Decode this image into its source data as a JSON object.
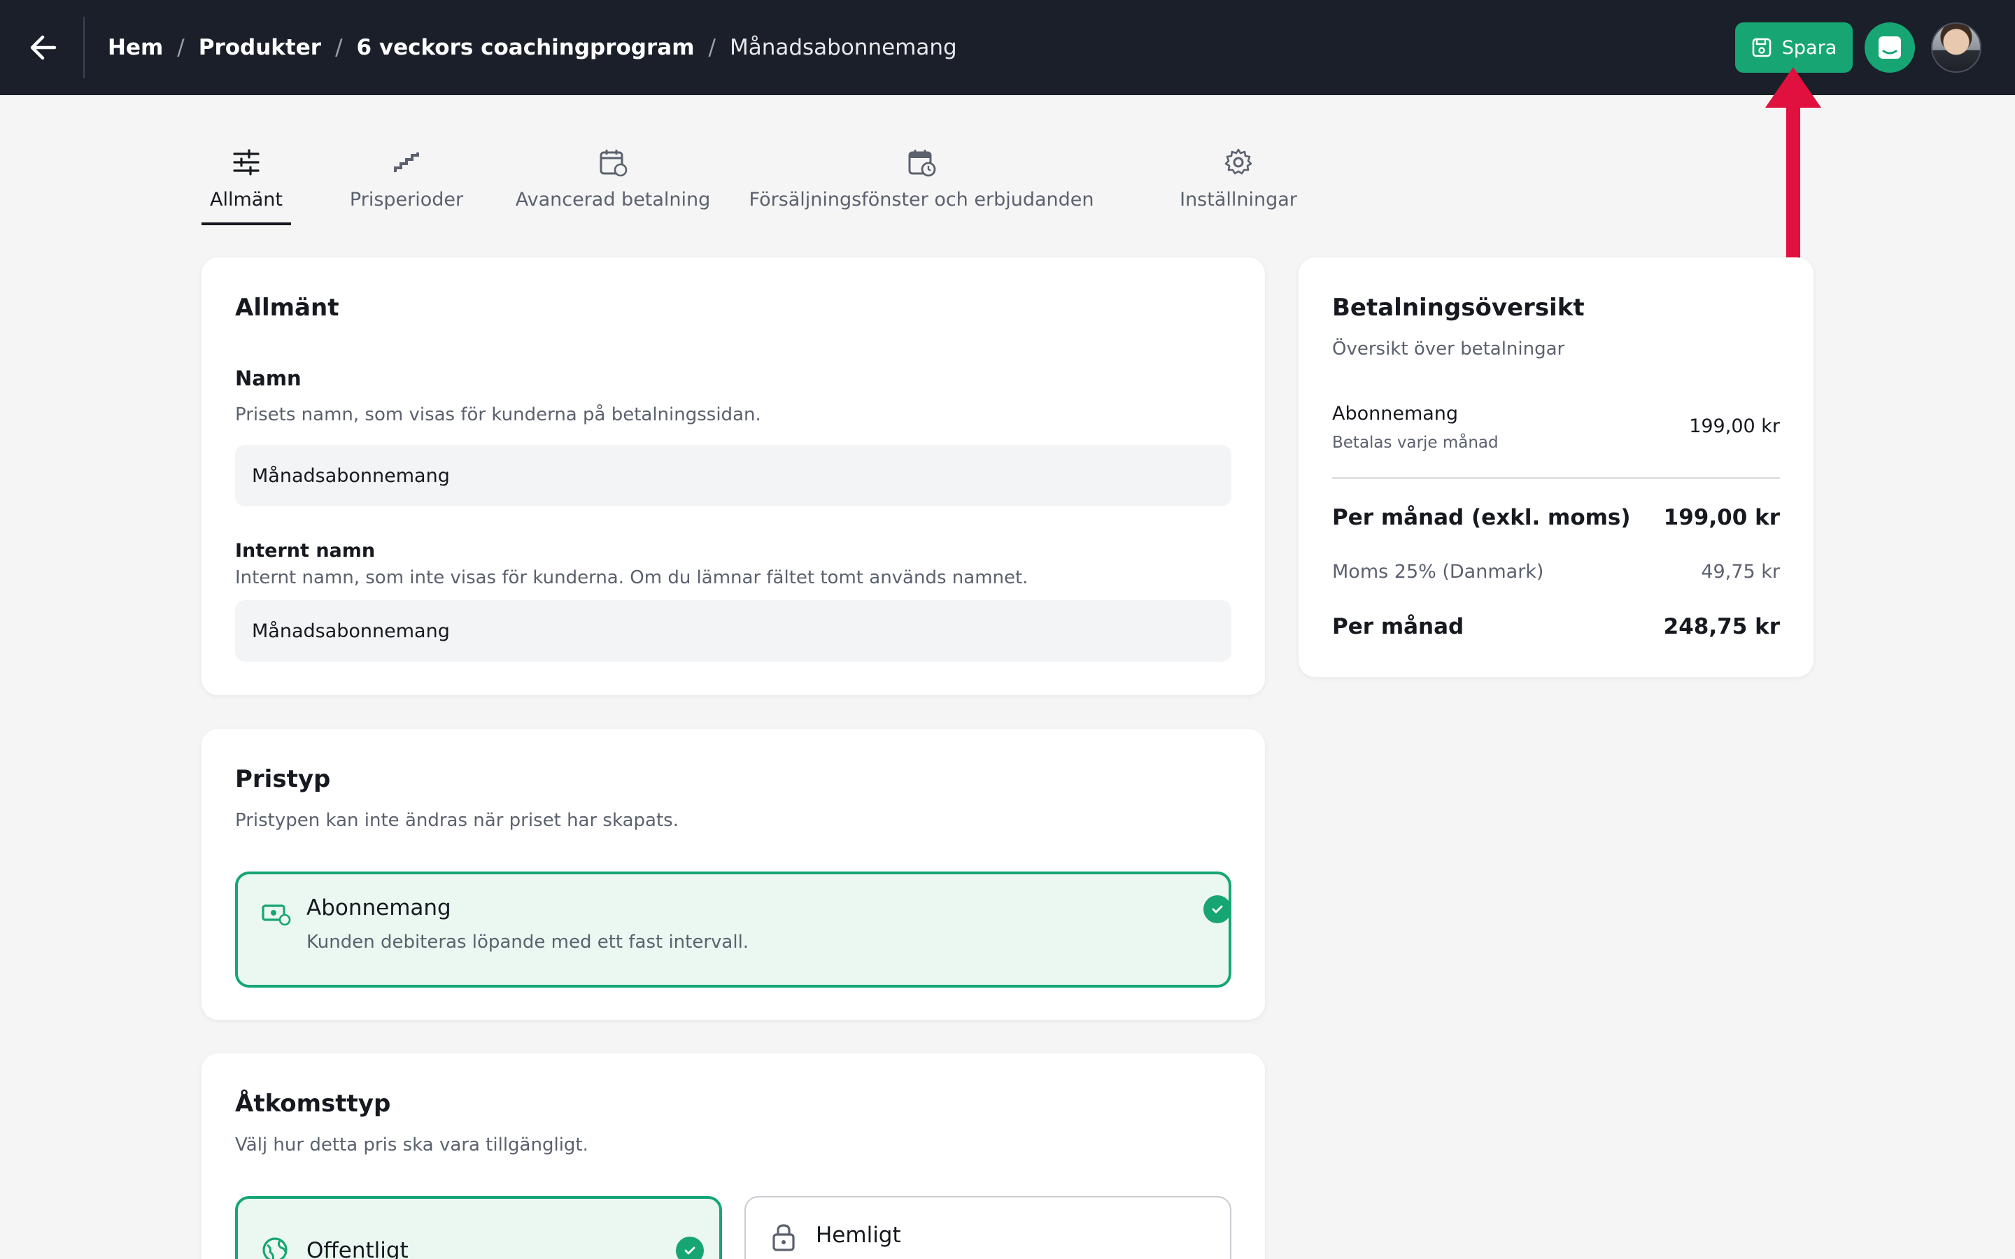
{
  "header": {
    "breadcrumb": [
      {
        "label": "Hem"
      },
      {
        "label": "Produkter"
      },
      {
        "label": "6 veckors coachingprogram"
      },
      {
        "label": "Månadsabonnemang"
      }
    ],
    "save_label": "Spara"
  },
  "tabs": [
    {
      "label": "Allmänt",
      "active": true
    },
    {
      "label": "Prisperioder"
    },
    {
      "label": "Avancerad betalning"
    },
    {
      "label": "Försäljningsfönster och erbjudanden"
    },
    {
      "label": "Inställningar"
    }
  ],
  "general": {
    "title": "Allmänt",
    "name_label": "Namn",
    "name_help": "Prisets namn, som visas för kunderna på betalningssidan.",
    "name_value": "Månadsabonnemang",
    "internal_label": "Internt namn",
    "internal_help": "Internt namn, som inte visas för kunderna. Om du lämnar fältet tomt används namnet.",
    "internal_value": "Månadsabonnemang"
  },
  "price_type": {
    "title": "Pristyp",
    "subtitle": "Pristypen kan inte ändras när priset har skapats.",
    "option_title": "Abonnemang",
    "option_desc": "Kunden debiteras löpande med ett fast intervall."
  },
  "access": {
    "title": "Åtkomsttyp",
    "subtitle": "Välj hur detta pris ska vara tillgängligt.",
    "public_label": "Offentligt",
    "secret_label": "Hemligt"
  },
  "summary": {
    "title": "Betalningsöversikt",
    "subtitle": "Översikt över betalningar",
    "item_label": "Abonnemang",
    "item_sub": "Betalas varje månad",
    "item_price": "199,00 kr",
    "per_month_ex_label": "Per månad (exkl. moms)",
    "per_month_ex_value": "199,00 kr",
    "vat_label": "Moms 25% (Danmark)",
    "vat_value": "49,75 kr",
    "per_month_label": "Per månad",
    "per_month_value": "248,75 kr"
  },
  "colors": {
    "accent": "#17a673",
    "topbar": "#1a1f29",
    "annotation": "#e0103f"
  }
}
